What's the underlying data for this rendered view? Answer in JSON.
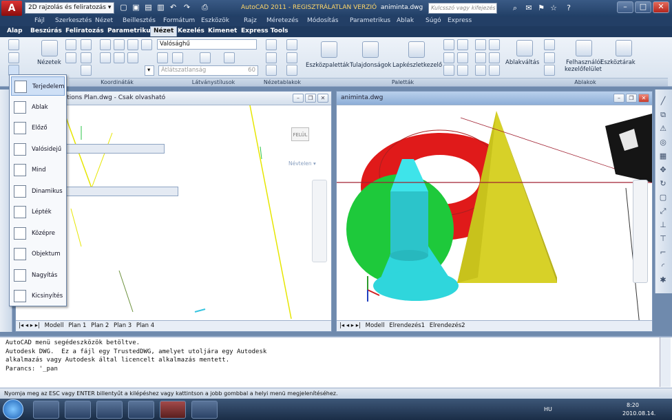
{
  "titlebar": {
    "workspace": "2D rajzolás és feliratozás",
    "title_prefix": "AutoCAD 2011 - REGISZTRÁLATLAN VERZIÓ",
    "file": "animinta.dwg",
    "search_placeholder": "Kulcsszó vagy kifejezés"
  },
  "menubar": [
    "Fájl",
    "Szerkesztés",
    "Nézet",
    "Beillesztés",
    "Formátum",
    "Eszközök",
    "Rajz",
    "Méretezés",
    "Módosítás",
    "Parametrikus",
    "Ablak",
    "Súgó",
    "Express"
  ],
  "tabs": [
    "Alap",
    "Beszúrás",
    "Feliratozás",
    "Parametrikus",
    "Nézet",
    "Kezelés",
    "Kimenet",
    "Express Tools"
  ],
  "ribbon": {
    "nezetek": "Nézetek",
    "koordinatak": "Koordináták",
    "visual_style": "Valósághű",
    "lathatatlan": "Átlátszatlanság",
    "lathatatlan_val": "60",
    "vizualstilusok": "Látványstílusok",
    "nezetablakok": "Nézetablakok",
    "eszkozpaletta": "Eszközpaletták",
    "tulajdonsagok": "Tulajdonságok",
    "lapkeszlet": "Lapkészletkezelő",
    "palettak": "Paletták",
    "ablakvaltas": "Ablakváltás",
    "felhasznaloi": "Felhasználói",
    "kezelofelulet": "kezelőfelület",
    "eszkoztarak": "Eszköztárak",
    "ablakok": "Ablakok"
  },
  "flyout": [
    {
      "label": "Terjedelem",
      "highlight": true
    },
    {
      "label": "Ablak"
    },
    {
      "label": "Előző"
    },
    {
      "label": "Valósidejű"
    },
    {
      "label": "Mind"
    },
    {
      "label": "Dinamikus"
    },
    {
      "label": "Lépték"
    },
    {
      "label": "Középre"
    },
    {
      "label": "Objektum"
    },
    {
      "label": "Nagyítás"
    },
    {
      "label": "Kicsinyítés"
    }
  ],
  "left_viewport": {
    "title": "ditions Plan.dwg - Csak olvasható",
    "view_label": "Névtelen",
    "tabs": [
      "Modell",
      "Plan 1",
      "Plan 2",
      "Plan 3",
      "Plan 4"
    ]
  },
  "right_viewport": {
    "title": "animinta.dwg",
    "tabs": [
      "Modell",
      "Elrendezés1",
      "Elrendezés2"
    ]
  },
  "command": {
    "lines": [
      "AutoCAD menü segédeszközök betöltve.",
      "Autodesk DWG.  Ez a fájl egy TrustedDWG, amelyet utoljára egy Autodesk",
      "alkalmazás vagy Autodesk által licencelt alkalmazás mentett.",
      "Parancs: '_pan"
    ]
  },
  "statusbar": "Nyomja meg az ESC vagy ENTER billentyűt a kilépéshez vagy kattintson a jobb gombbal a helyi menü megjelenítéséhez.",
  "tray": {
    "lang": "HU",
    "time": "8:20",
    "date": "2010.08.14."
  },
  "colors": {
    "torus": "#e02020",
    "cone": "#36e0e6",
    "sphere": "#1ec93b",
    "pyramid": "#d7d128"
  }
}
